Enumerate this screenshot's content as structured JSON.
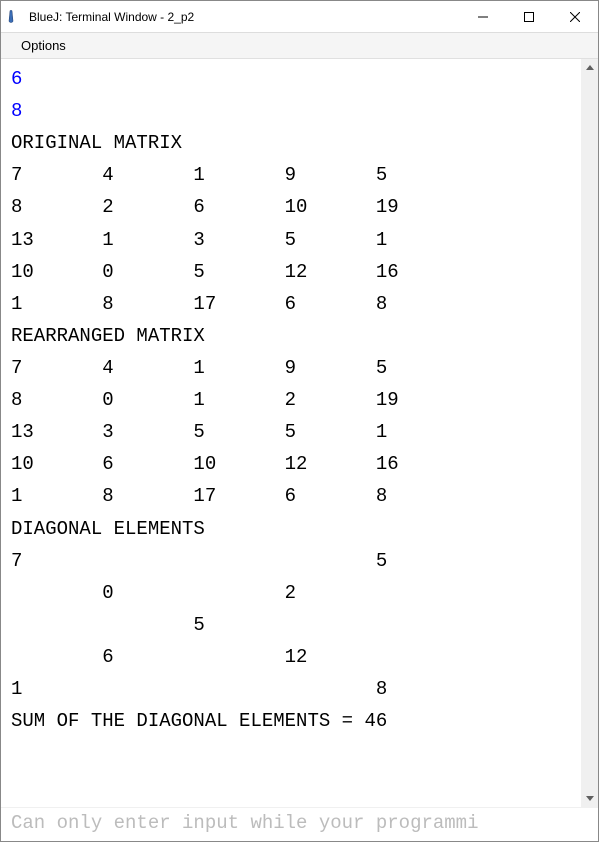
{
  "window": {
    "title": "BlueJ: Terminal Window - 2_p2"
  },
  "menu": {
    "options": "Options"
  },
  "terminal": {
    "inputs": [
      "6",
      "8"
    ],
    "label_original": "ORIGINAL MATRIX",
    "original_matrix": [
      [
        7,
        4,
        1,
        9,
        5
      ],
      [
        8,
        2,
        6,
        10,
        19
      ],
      [
        13,
        1,
        3,
        5,
        1
      ],
      [
        10,
        0,
        5,
        12,
        16
      ],
      [
        1,
        8,
        17,
        6,
        8
      ]
    ],
    "label_rearranged": "REARRANGED MATRIX",
    "rearranged_matrix": [
      [
        7,
        4,
        1,
        9,
        5
      ],
      [
        8,
        0,
        1,
        2,
        19
      ],
      [
        13,
        3,
        5,
        5,
        1
      ],
      [
        10,
        6,
        10,
        12,
        16
      ],
      [
        1,
        8,
        17,
        6,
        8
      ]
    ],
    "label_diagonal": "DIAGONAL ELEMENTS",
    "diagonal_matrix": [
      [
        7,
        null,
        null,
        null,
        5
      ],
      [
        null,
        0,
        null,
        2,
        null
      ],
      [
        null,
        null,
        5,
        null,
        null
      ],
      [
        null,
        6,
        null,
        12,
        null
      ],
      [
        1,
        null,
        null,
        null,
        8
      ]
    ],
    "sum_line": "SUM OF THE DIAGONAL ELEMENTS = 46",
    "sum_value": 46
  },
  "status": {
    "message": "Can only enter input while your programmi"
  }
}
